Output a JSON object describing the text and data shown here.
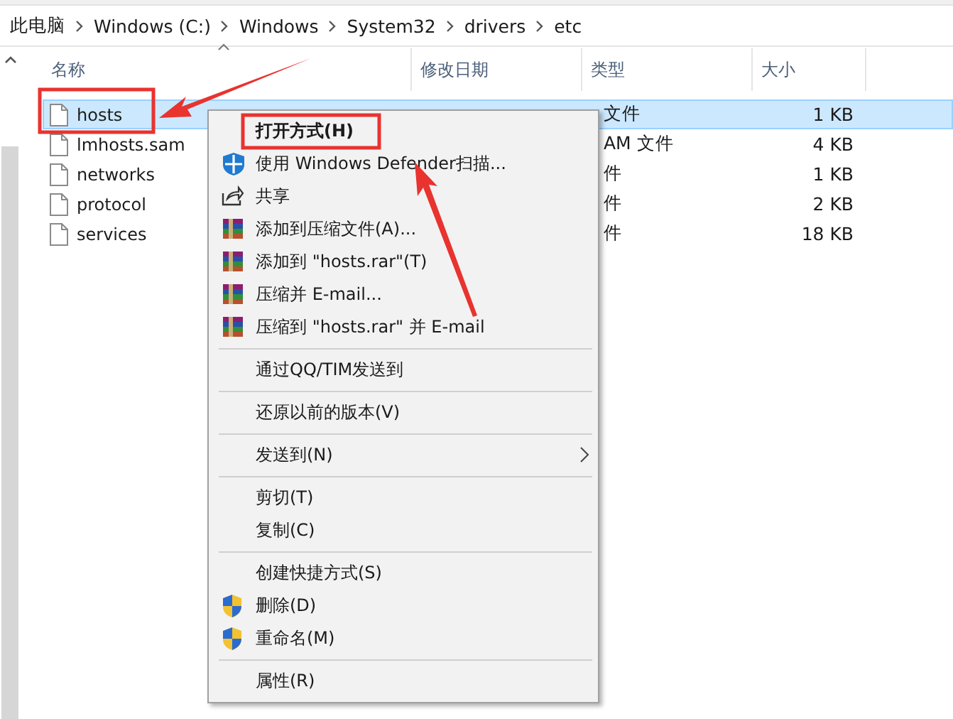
{
  "breadcrumb": [
    "此电脑",
    "Windows (C:)",
    "Windows",
    "System32",
    "drivers",
    "etc"
  ],
  "columns": [
    {
      "label": "名称",
      "sorted": true
    },
    {
      "label": "修改日期",
      "sorted": false
    },
    {
      "label": "类型",
      "sorted": false
    },
    {
      "label": "大小",
      "sorted": false
    }
  ],
  "rows": [
    {
      "name": "hosts",
      "type": "文件",
      "size": "1 KB",
      "selected": true
    },
    {
      "name": "lmhosts.sam",
      "type": "AM 文件",
      "size": "4 KB",
      "selected": false
    },
    {
      "name": "networks",
      "type": "件",
      "size": "1 KB",
      "selected": false
    },
    {
      "name": "protocol",
      "type": "件",
      "size": "2 KB",
      "selected": false
    },
    {
      "name": "services",
      "type": "件",
      "size": "18 KB",
      "selected": false
    }
  ],
  "context_menu": {
    "groups": [
      [
        {
          "label": "打开方式(H)",
          "kind": "plain",
          "bold": true,
          "submenu": false
        },
        {
          "label": "使用 Windows Defender扫描...",
          "kind": "defender",
          "bold": false,
          "submenu": false
        },
        {
          "label": "共享",
          "kind": "share",
          "bold": false,
          "submenu": false
        },
        {
          "label": "添加到压缩文件(A)...",
          "kind": "archive",
          "bold": false,
          "submenu": false
        },
        {
          "label": "添加到 \"hosts.rar\"(T)",
          "kind": "archive",
          "bold": false,
          "submenu": false
        },
        {
          "label": "压缩并 E-mail...",
          "kind": "archive",
          "bold": false,
          "submenu": false
        },
        {
          "label": "压缩到 \"hosts.rar\" 并 E-mail",
          "kind": "archive",
          "bold": false,
          "submenu": false
        }
      ],
      [
        {
          "label": "通过QQ/TIM发送到",
          "kind": "plain",
          "bold": false,
          "submenu": false
        }
      ],
      [
        {
          "label": "还原以前的版本(V)",
          "kind": "plain",
          "bold": false,
          "submenu": false
        }
      ],
      [
        {
          "label": "发送到(N)",
          "kind": "plain",
          "bold": false,
          "submenu": true
        }
      ],
      [
        {
          "label": "剪切(T)",
          "kind": "plain",
          "bold": false,
          "submenu": false
        },
        {
          "label": "复制(C)",
          "kind": "plain",
          "bold": false,
          "submenu": false
        }
      ],
      [
        {
          "label": "创建快捷方式(S)",
          "kind": "plain",
          "bold": false,
          "submenu": false
        },
        {
          "label": "删除(D)",
          "kind": "uac",
          "bold": false,
          "submenu": false
        },
        {
          "label": "重命名(M)",
          "kind": "uac",
          "bold": false,
          "submenu": false
        }
      ],
      [
        {
          "label": "属性(R)",
          "kind": "plain",
          "bold": false,
          "submenu": false
        }
      ]
    ]
  }
}
